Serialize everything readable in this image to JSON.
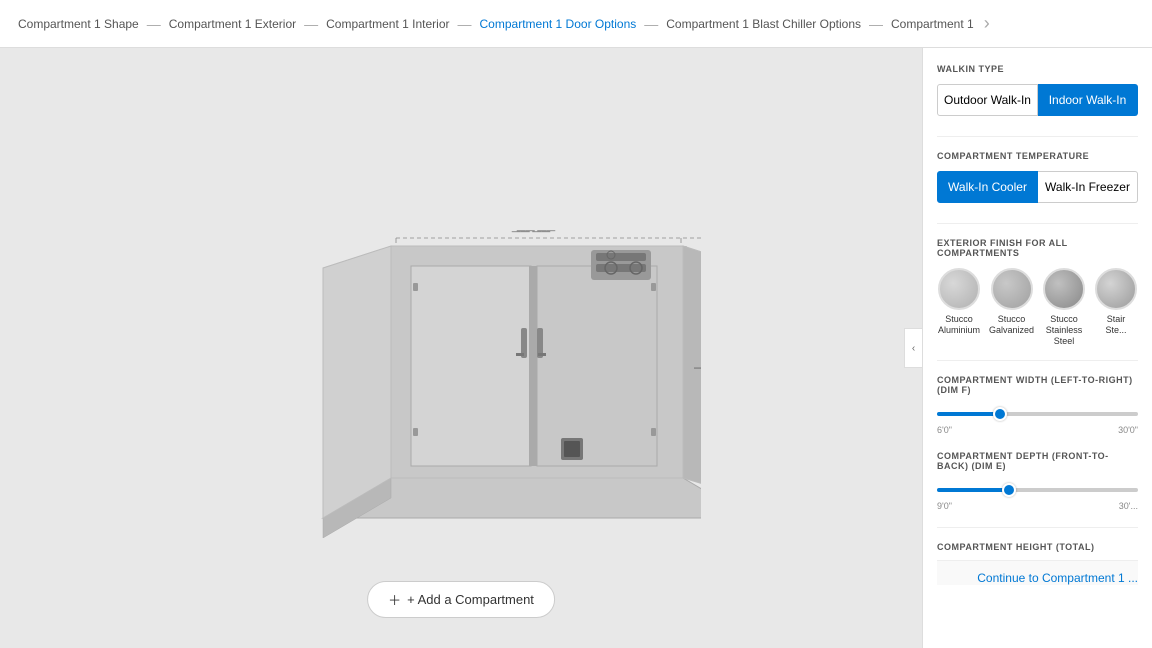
{
  "breadcrumb": {
    "items": [
      {
        "id": "shape",
        "label": "Compartment 1 Shape",
        "active": false
      },
      {
        "id": "exterior",
        "label": "Compartment 1 Exterior",
        "active": false
      },
      {
        "id": "interior",
        "label": "Compartment 1 Interior",
        "active": false
      },
      {
        "id": "door",
        "label": "Compartment 1 Door Options",
        "active": false
      },
      {
        "id": "blast",
        "label": "Compartment 1 Blast Chiller Options",
        "active": false
      },
      {
        "id": "comp2",
        "label": "Compartment 1",
        "active": false
      }
    ],
    "more_icon": "›"
  },
  "right_panel": {
    "walkin_type_label": "WALKIN TYPE",
    "outdoor_label": "Outdoor Walk-In",
    "indoor_label": "Indoor Walk-In",
    "indoor_active": true,
    "temperature_label": "COMPARTMENT TEMPERATURE",
    "cooler_label": "Walk-In Cooler",
    "freezer_label": "Walk-In Freezer",
    "cooler_active": true,
    "exterior_finish_label": "EXTERIOR FINISH FOR ALL COMPARTMENTS",
    "finishes": [
      {
        "id": "stucco-alum",
        "label": "Stucco\nAluminium",
        "style": "stucco-alum"
      },
      {
        "id": "stucco-galv",
        "label": "Stucco\nGalvanized",
        "style": "stucco-galv"
      },
      {
        "id": "stucco-ss",
        "label": "Stucco\nStainless\nSteel",
        "style": "stucco-ss"
      },
      {
        "id": "stain-ss",
        "label": "Stair\nSte...",
        "style": "stain-ss"
      }
    ],
    "width_label": "COMPARTMENT WIDTH (LEFT-TO-RIGHT) (DIM F)",
    "width_min": "6'0\"",
    "width_max": "30'0\"",
    "width_value": 30,
    "depth_label": "COMPARTMENT DEPTH (FRONT-TO-BACK) (DIM E)",
    "depth_min": "9'0\"",
    "depth_max": "30'...",
    "depth_value": 35,
    "height_label": "COMPARTMENT HEIGHT (TOTAL)",
    "continue_label": "Continue to Compartment 1 ..."
  },
  "add_compartment_label": "+ Add a Compartment",
  "collapse_icon": "‹"
}
